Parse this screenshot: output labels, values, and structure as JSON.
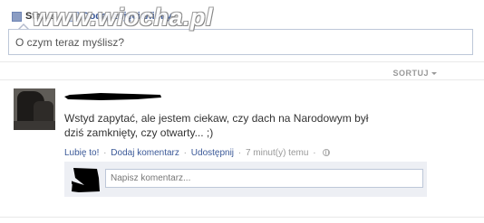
{
  "composer": {
    "tabs": [
      {
        "label": "Status",
        "icon": "status-icon"
      },
      {
        "label": "Dodaj zdjęcia/filmy",
        "icon": "photo-icon"
      }
    ],
    "placeholder": "O czym teraz myślisz?"
  },
  "watermark": "www.wiocha.pl",
  "feed": {
    "sort_label": "SORTUJ"
  },
  "post": {
    "text": "Wstyd zapytać, ale jestem ciekaw, czy dach na Narodowym był dziś zamknięty, czy otwarty... ;)",
    "actions": {
      "like": "Lubię to!",
      "comment": "Dodaj komentarz",
      "share": "Udostępnij",
      "time": "7 minut(y) temu",
      "separator": "·",
      "privacy_icon": "globe-icon"
    },
    "comment_placeholder": "Napisz komentarz..."
  },
  "colors": {
    "link": "#3b5998",
    "muted": "#999999",
    "border": "#bdc7d8",
    "comment_bg": "#edeff4"
  }
}
